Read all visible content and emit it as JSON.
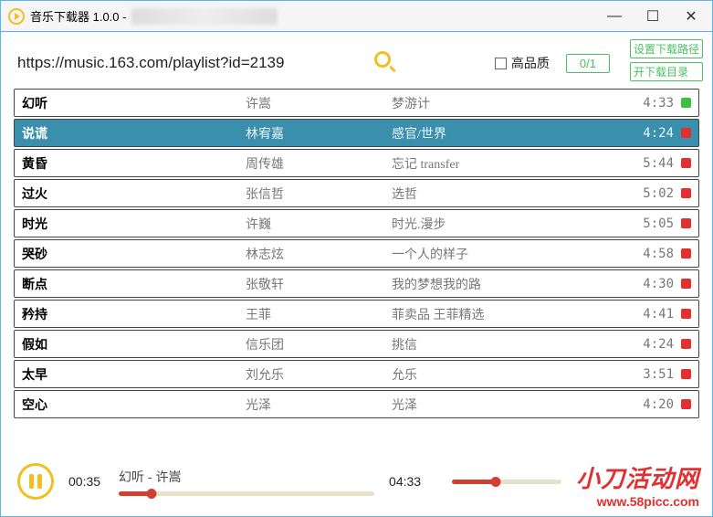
{
  "window": {
    "title": "音乐下载器 1.0.0 -"
  },
  "toolbar": {
    "url": "https://music.163.com/playlist?id=2139",
    "hq_label": "高品质",
    "counter": "0/1",
    "btn_set_path": "设置下载路径",
    "btn_open_dir": "开下载目录"
  },
  "tracks": [
    {
      "title": "幻听",
      "artist": "许嵩",
      "album": "梦游计",
      "dur": "4:33",
      "status": "green",
      "selected": false
    },
    {
      "title": "说谎",
      "artist": "林宥嘉",
      "album": "感官/世界",
      "dur": "4:24",
      "status": "red",
      "selected": true
    },
    {
      "title": "黄昏",
      "artist": "周传雄",
      "album": "忘记 transfer",
      "dur": "5:44",
      "status": "red",
      "selected": false
    },
    {
      "title": "过火",
      "artist": "张信哲",
      "album": "选哲",
      "dur": "5:02",
      "status": "red",
      "selected": false
    },
    {
      "title": "时光",
      "artist": "许巍",
      "album": "时光.漫步",
      "dur": "5:05",
      "status": "red",
      "selected": false
    },
    {
      "title": "哭砂",
      "artist": "林志炫",
      "album": "一个人的样子",
      "dur": "4:58",
      "status": "red",
      "selected": false
    },
    {
      "title": "断点",
      "artist": "张敬轩",
      "album": "我的梦想我的路",
      "dur": "4:30",
      "status": "red",
      "selected": false
    },
    {
      "title": "矜持",
      "artist": "王菲",
      "album": "菲卖品 王菲精选",
      "dur": "4:41",
      "status": "red",
      "selected": false
    },
    {
      "title": "假如",
      "artist": "信乐团",
      "album": "挑信",
      "dur": "4:24",
      "status": "red",
      "selected": false
    },
    {
      "title": "太早",
      "artist": "刘允乐",
      "album": "允乐",
      "dur": "3:51",
      "status": "red",
      "selected": false
    },
    {
      "title": "空心",
      "artist": "光泽",
      "album": "光泽",
      "dur": "4:20",
      "status": "red",
      "selected": false
    }
  ],
  "player": {
    "now_playing": "幻听 - 许嵩",
    "elapsed": "00:35",
    "total": "04:33",
    "progress_pct": 13,
    "volume_pct": 40
  },
  "watermark": {
    "cn": "小刀活动网",
    "url": "www.58picc.com"
  }
}
